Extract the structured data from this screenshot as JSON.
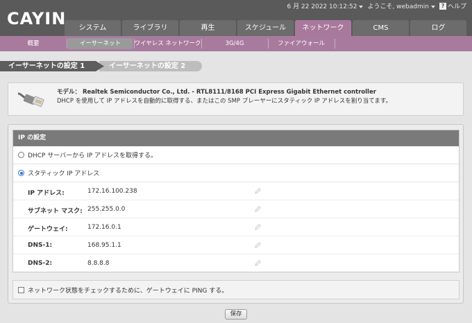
{
  "header": {
    "logo": "CAYIN",
    "datetime": "6 月 22 2022 10:12:52",
    "welcome": "ようこそ, webadmin",
    "help_label": "ヘルプ"
  },
  "main_tabs": [
    {
      "label": "システム"
    },
    {
      "label": "ライブラリ"
    },
    {
      "label": "再生"
    },
    {
      "label": "スケジュール"
    },
    {
      "label": "ネットワーク",
      "active": true
    },
    {
      "label": "CMS"
    },
    {
      "label": "ログ"
    }
  ],
  "sub_tabs": [
    {
      "label": "概要"
    },
    {
      "label": "イーサーネット",
      "active": true
    },
    {
      "label": "ワイヤレス ネットワーク"
    },
    {
      "label": "3G/4G"
    },
    {
      "label": "ファイアウォール"
    }
  ],
  "page_tabs": [
    {
      "label": "イーサーネットの設定 1",
      "active": true
    },
    {
      "label": "イーサーネットの設定 2"
    }
  ],
  "info": {
    "model_line": "モデル： Realtek Semiconductor Co., Ltd. - RTL8111/8168 PCI Express Gigabit Ethernet controller",
    "description": "DHCP を使用して IP アドレスを自動的に取得する、またはこの SMP プレーヤーにスタティック IP アドレスを割り当てます。"
  },
  "ip_settings": {
    "title": "IP の設定",
    "dhcp_option": "DHCP サーバーから IP アドレスを取得する。",
    "static_option": "スタティック IP アドレス",
    "selected": "static",
    "fields": [
      {
        "label": "IP アドレス:",
        "value": "172.16.100.238"
      },
      {
        "label": "サブネット マスク:",
        "value": "255.255.0.0"
      },
      {
        "label": "ゲートウェイ:",
        "value": "172.16.0.1"
      },
      {
        "label": "DNS-1:",
        "value": "168.95.1.1"
      },
      {
        "label": "DNS-2:",
        "value": "8.8.8.8"
      }
    ]
  },
  "ping_option": {
    "label": "ネットワーク状態をチェックするために、ゲートウェイに PING する。",
    "checked": false
  },
  "save_label": "保存",
  "colors": {
    "accent": "#a8799c",
    "header_bg": "#5a5a5a",
    "radio_selected": "#2f6fd0"
  }
}
